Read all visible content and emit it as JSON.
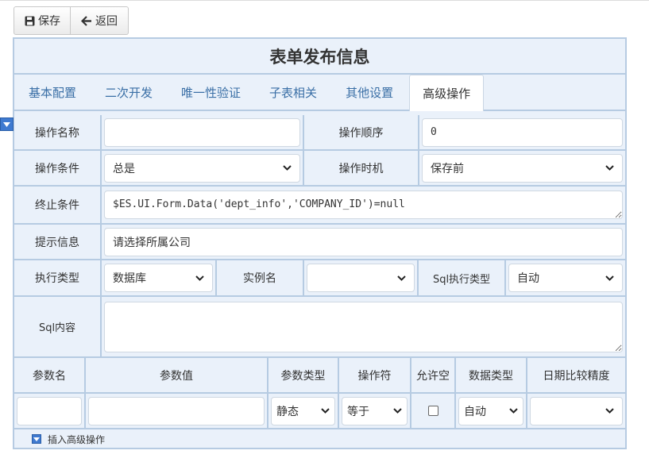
{
  "toolbar": {
    "save_label": "保存",
    "back_label": "返回"
  },
  "form": {
    "title": "表单发布信息",
    "tabs": [
      "基本配置",
      "二次开发",
      "唯一性验证",
      "子表相关",
      "其他设置",
      "高级操作"
    ],
    "active_tab": "高级操作",
    "labels": {
      "op_name": "操作名称",
      "op_order": "操作顺序",
      "op_condition": "操作条件",
      "op_timing": "操作时机",
      "stop_condition": "终止条件",
      "hint": "提示信息",
      "exec_type": "执行类型",
      "instance_name": "实例名",
      "sql_exec_type": "Sql执行类型",
      "sql_content": "Sql内容"
    },
    "values": {
      "op_name": "",
      "op_order": "0",
      "op_condition": "总是",
      "op_timing": "保存前",
      "stop_condition": "$ES.UI.Form.Data('dept_info','COMPANY_ID')=null",
      "hint": "请选择所属公司",
      "exec_type": "数据库",
      "instance_name": "",
      "sql_exec_type": "自动",
      "sql_content": ""
    },
    "param_table": {
      "headers": [
        "参数名",
        "参数值",
        "参数类型",
        "操作符",
        "允许空",
        "数据类型",
        "日期比较精度"
      ],
      "row": {
        "name": "",
        "value": "",
        "type": "静态",
        "operator": "等于",
        "allow_null": false,
        "data_type": "自动",
        "date_precision": ""
      }
    },
    "footer_label": "插入高级操作"
  },
  "colors": {
    "panel_bg": "#eaf1fa",
    "border": "#b6cbe2",
    "tab_text": "#3a6fa6",
    "accent": "#3f7ad0"
  },
  "icons": [
    "floppy-disk-icon",
    "arrow-left-icon",
    "chevron-down-icon",
    "collapse-toggle-icon"
  ]
}
